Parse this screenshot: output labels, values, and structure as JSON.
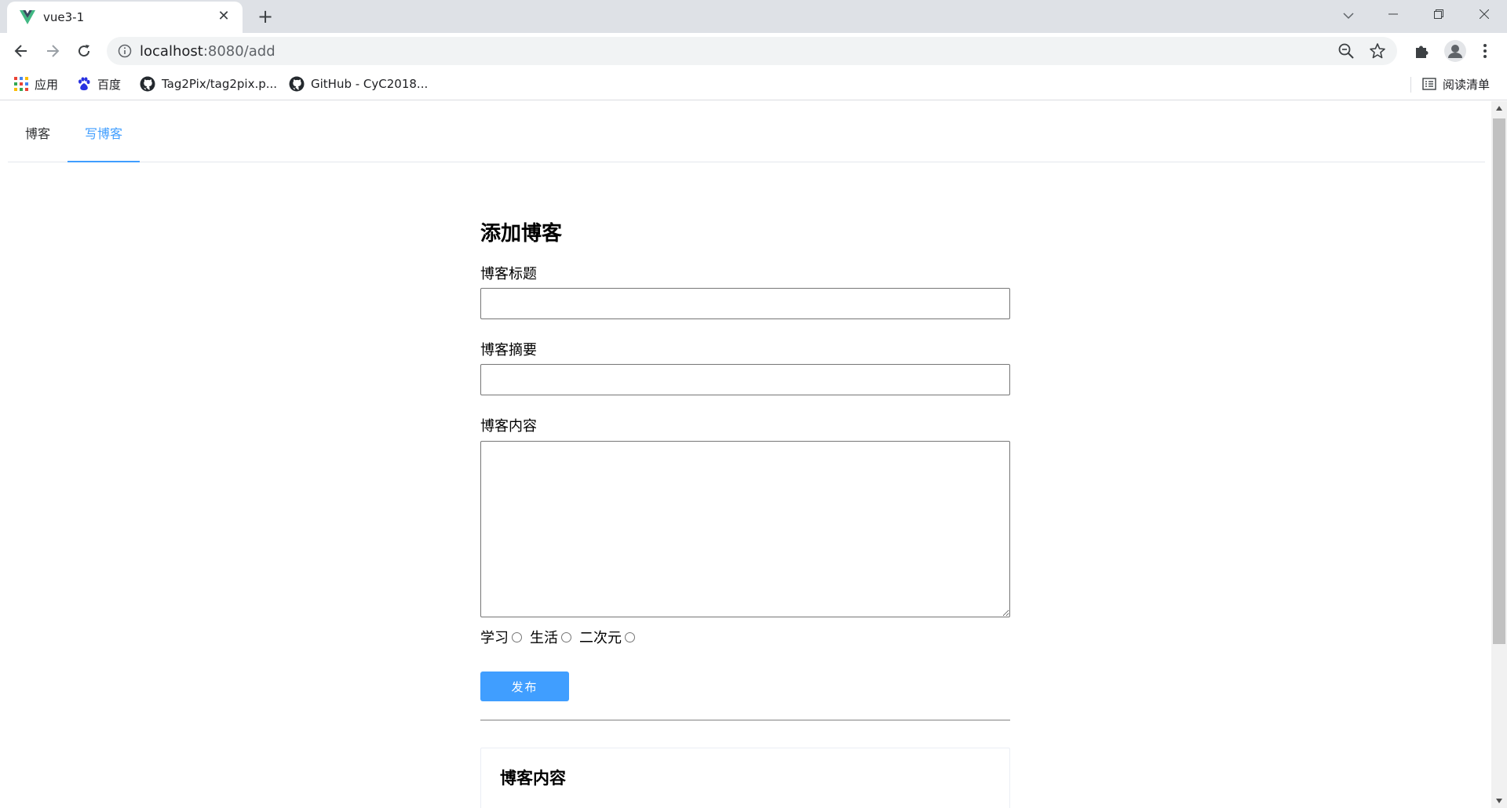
{
  "browser": {
    "tab_title": "vue3-1",
    "url_host": "localhost",
    "url_rest": ":8080/add",
    "bookmarks": [
      {
        "label": "应用"
      },
      {
        "label": "百度"
      },
      {
        "label": "Tag2Pix/tag2pix.p..."
      },
      {
        "label": "GitHub - CyC2018..."
      }
    ],
    "reading_list": "阅读清单",
    "accent_color": "#409eff"
  },
  "app": {
    "menu": [
      {
        "label": "博客"
      },
      {
        "label": "写博客"
      }
    ],
    "form": {
      "heading": "添加博客",
      "title_label": "博客标题",
      "title_value": "",
      "summary_label": "博客摘要",
      "summary_value": "",
      "content_label": "博客内容",
      "content_value": "",
      "categories": [
        {
          "label": "学习",
          "checked": false
        },
        {
          "label": "生活",
          "checked": false
        },
        {
          "label": "二次元",
          "checked": false
        }
      ],
      "publish_label": "发布"
    },
    "preview": {
      "heading": "博客内容"
    }
  }
}
